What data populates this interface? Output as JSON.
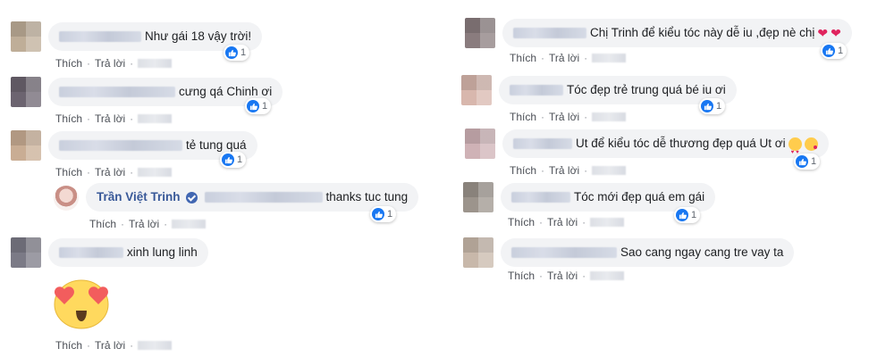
{
  "labels": {
    "like": "Thích",
    "reply": "Trả lời"
  },
  "left": [
    {
      "text": "Như gái 18 vậy trời!",
      "count": "1"
    },
    {
      "text": "cưng qá Chinh ơi",
      "count": "1"
    },
    {
      "text": "tẻ tung quá",
      "count": "1"
    },
    {
      "author": "Trần Việt Trinh",
      "text": "thanks tuc tung",
      "count": "1"
    },
    {
      "text": "xinh lung linh",
      "sticker": "heart-eyes-emoji"
    }
  ],
  "right": [
    {
      "text": "Chị Trinh để kiểu tóc này dễ iu ,đẹp nè chị",
      "count": "1"
    },
    {
      "text": "Tóc đẹp trẻ trung quá bé iu ơi",
      "count": "1"
    },
    {
      "text": "Ut để kiểu tóc dễ thương đẹp quá Ut ơi",
      "count": "1"
    },
    {
      "text": "Tóc mới đẹp quá em gái",
      "count": "1"
    },
    {
      "text": "Sao cang ngay cang tre vay ta"
    }
  ],
  "colors": {
    "bubble": "#f2f3f5",
    "link": "#385898",
    "like": "#1877f2",
    "heart": "#e0245e"
  }
}
